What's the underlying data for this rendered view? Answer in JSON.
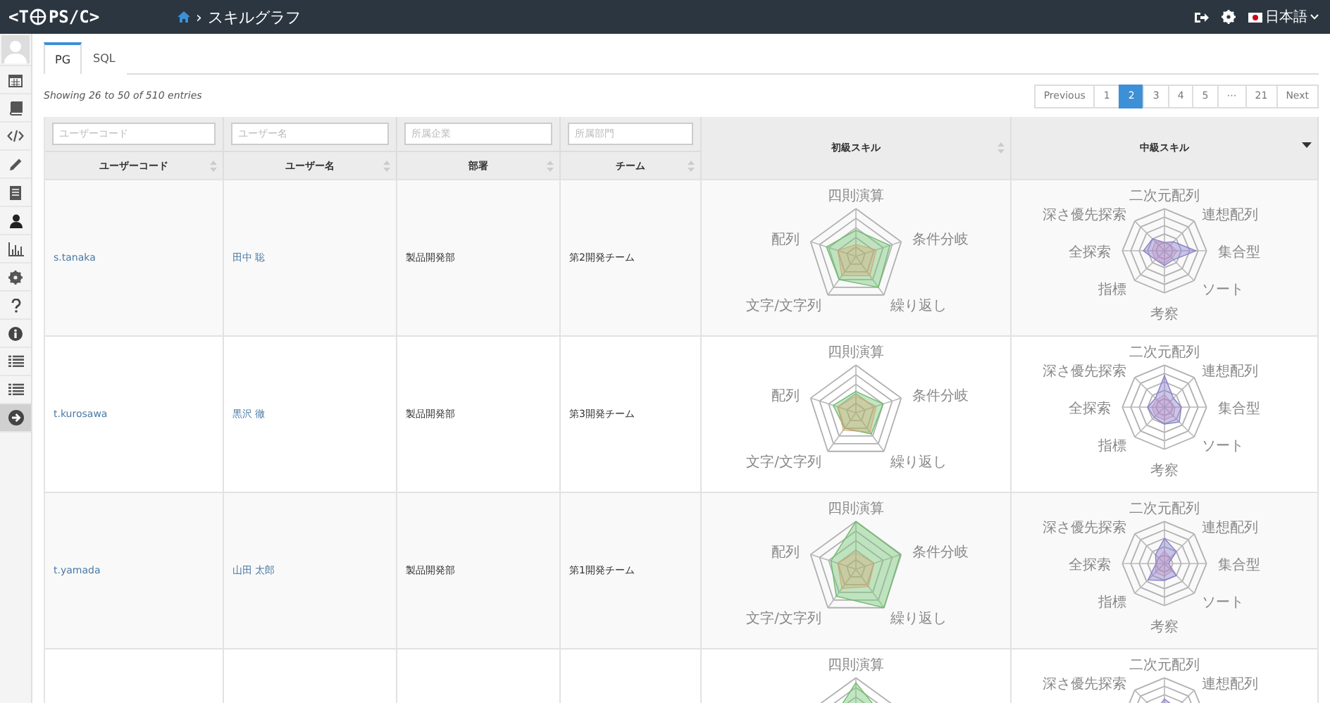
{
  "header": {
    "logo": {
      "before": "<T",
      "after": "PS/C>"
    },
    "breadcrumb": {
      "separator": "›",
      "title": "スキルグラフ"
    },
    "language": "日本語"
  },
  "sidebar": {
    "items": [
      {
        "kind": "avatar",
        "selected": false
      },
      {
        "kind": "calendar",
        "selected": false
      },
      {
        "kind": "book",
        "selected": false
      },
      {
        "kind": "code",
        "selected": false
      },
      {
        "kind": "pencil",
        "selected": false
      },
      {
        "kind": "document",
        "selected": false
      },
      {
        "kind": "user",
        "selected": false
      },
      {
        "kind": "chart",
        "selected": false
      },
      {
        "kind": "gear",
        "selected": false
      },
      {
        "kind": "help",
        "selected": false
      },
      {
        "kind": "info",
        "selected": false
      },
      {
        "kind": "list",
        "selected": false
      },
      {
        "kind": "list",
        "selected": false
      },
      {
        "kind": "arrow",
        "selected": true
      }
    ]
  },
  "tabs": [
    {
      "label": "PG",
      "selected": true
    },
    {
      "label": "SQL",
      "selected": false
    }
  ],
  "summary": "Showing 26 to 50 of 510 entries",
  "pagination": [
    {
      "label": "Previous",
      "selected": false
    },
    {
      "label": "1",
      "selected": false
    },
    {
      "label": "2",
      "selected": true
    },
    {
      "label": "3",
      "selected": false
    },
    {
      "label": "4",
      "selected": false
    },
    {
      "label": "5",
      "selected": false
    },
    {
      "label": "⋯",
      "selected": false
    },
    {
      "label": "21",
      "selected": false
    },
    {
      "label": "Next",
      "selected": false
    }
  ],
  "table": {
    "filters": [
      {
        "placeholder": "ユーザーコード"
      },
      {
        "placeholder": "ユーザー名"
      },
      {
        "placeholder": "所属企業"
      },
      {
        "placeholder": "所属部門"
      }
    ],
    "columns": [
      "ユーザーコード",
      "ユーザー名",
      "部署",
      "チーム",
      "初級スキル",
      "中級スキル"
    ],
    "rows": [
      {
        "user_code": "s.tanaka",
        "user_name": "田中 聡",
        "department": "製品開発部",
        "team": "第2開発チーム",
        "beginner_labels": [
          "四則演算",
          "条件分岐",
          "繰り返し",
          "文字/文字列",
          "配列"
        ],
        "intermediate_labels": [
          "深さ優先探索",
          "二次元配列",
          "連想配列",
          "集合型",
          "ソート",
          "考察",
          "指標",
          "全探索"
        ]
      },
      {
        "user_code": "t.kurosawa",
        "user_name": "黒沢 徹",
        "department": "製品開発部",
        "team": "第3開発チーム",
        "beginner_labels": [
          "四則演算",
          "条件分岐",
          "繰り返し",
          "文字/文字列",
          "配列"
        ],
        "intermediate_labels": [
          "深さ優先探索",
          "二次元配列",
          "連想配列",
          "集合型",
          "ソート",
          "考察",
          "指標",
          "全探索"
        ]
      },
      {
        "user_code": "t.yamada",
        "user_name": "山田 太郎",
        "department": "製品開発部",
        "team": "第1開発チーム",
        "beginner_labels": [
          "四則演算",
          "条件分岐",
          "繰り返し",
          "文字/文字列",
          "配列"
        ],
        "intermediate_labels": [
          "深さ優先探索",
          "二次元配列",
          "連想配列",
          "集合型",
          "ソート",
          "考察",
          "指標",
          "全探索"
        ]
      },
      {
        "beginner_labels": [
          "四則演算"
        ],
        "intermediate_labels": [
          "深さ優先探索",
          "二次元配列",
          "連想配列"
        ]
      }
    ]
  }
}
